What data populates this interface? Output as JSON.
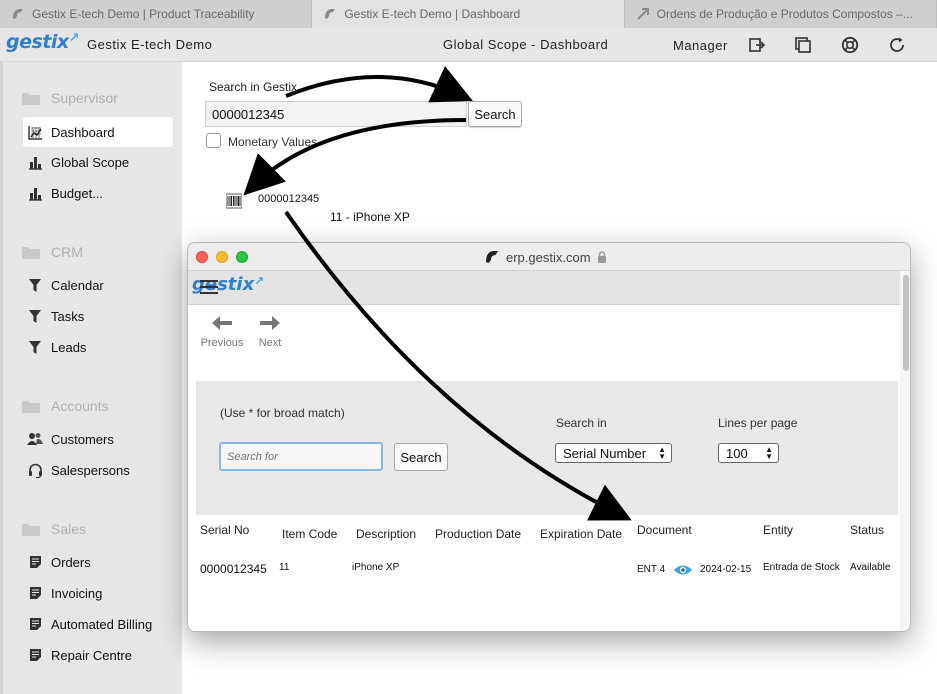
{
  "browser_tabs": [
    {
      "title": "Gestix E-tech Demo | Product Traceability",
      "active": false
    },
    {
      "title": "Gestix E-tech Demo | Dashboard",
      "active": true
    },
    {
      "title": "Ordens de Produção e Produtos Compostos –...",
      "active": false
    }
  ],
  "header": {
    "logo": "gestix",
    "company": "Gestix E-tech Demo",
    "page_title": "Global Scope - Dashboard",
    "role": "Manager",
    "icons": [
      "logout-icon",
      "windows-icon",
      "help-lifebuoy-icon",
      "refresh-icon"
    ]
  },
  "sidebar": {
    "sections": [
      {
        "label": "Supervisor",
        "items": [
          {
            "label": "Dashboard",
            "icon": "dashboard-icon",
            "active": true
          },
          {
            "label": "Global Scope",
            "icon": "bar-chart-icon"
          },
          {
            "label": "Budget...",
            "icon": "bar-chart-icon"
          }
        ]
      },
      {
        "label": "CRM",
        "items": [
          {
            "label": "Calendar",
            "icon": "funnel-icon"
          },
          {
            "label": "Tasks",
            "icon": "funnel-icon"
          },
          {
            "label": "Leads",
            "icon": "funnel-icon"
          }
        ]
      },
      {
        "label": "Accounts",
        "items": [
          {
            "label": "Customers",
            "icon": "users-icon"
          },
          {
            "label": "Salespersons",
            "icon": "headset-icon"
          }
        ]
      },
      {
        "label": "Sales",
        "items": [
          {
            "label": "Orders",
            "icon": "document-icon"
          },
          {
            "label": "Invoicing",
            "icon": "document-icon"
          },
          {
            "label": "Automated Billing",
            "icon": "document-icon"
          },
          {
            "label": "Repair Centre",
            "icon": "document-icon"
          }
        ]
      }
    ]
  },
  "search": {
    "label": "Search in Gestix",
    "value": "0000012345",
    "button": "Search",
    "checkbox_label": "Monetary Values",
    "checkbox_checked": false
  },
  "result": {
    "serial": "0000012345",
    "item": "11 - iPhone XP"
  },
  "popup": {
    "url": "erp.gestix.com",
    "logo": "gestix",
    "nav_prev": "Previous",
    "nav_next": "Next",
    "hint": "(Use * for broad match)",
    "search_placeholder": "Search for",
    "search_button": "Search",
    "search_in_label": "Search in",
    "search_in_value": "Serial Number",
    "lines_label": "Lines per page",
    "lines_value": "100",
    "columns": [
      "Serial No",
      "Item Code",
      "Description",
      "Production Date",
      "Expiration Date",
      "Document",
      "Entity",
      "Status"
    ],
    "rows": [
      {
        "serial": "0000012345",
        "item_code": "11",
        "description": "iPhone XP",
        "production_date": "",
        "expiration_date": "",
        "document": "ENT 4",
        "document_date": "2024-02-15",
        "entity": "Entrada de Stock",
        "status": "Available"
      }
    ]
  },
  "colors": {
    "brand_blue": "#2f7fd1",
    "sidebar_bg": "#e6e6e6",
    "focus_ring": "#8bb6e6",
    "eye_icon": "#3aa0d8"
  }
}
